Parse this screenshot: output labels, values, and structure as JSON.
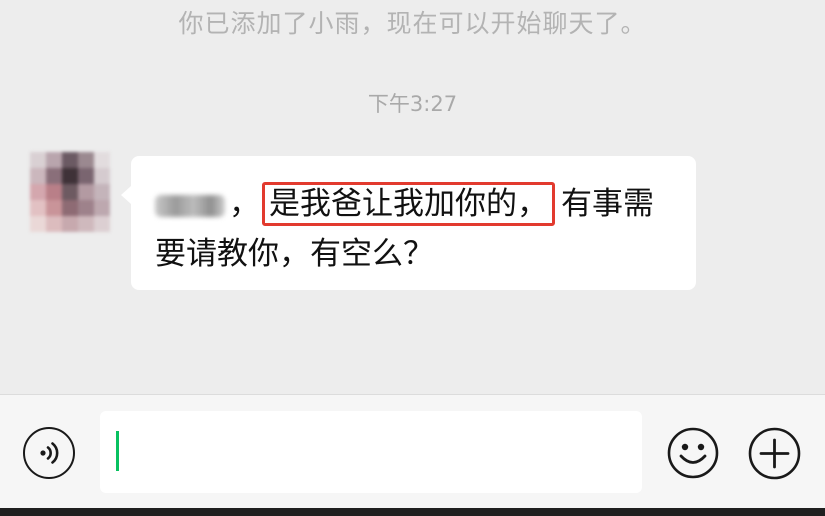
{
  "chat": {
    "system_notice": "你已添加了小雨，现在可以开始聊天了。",
    "timestamp": "下午3:27",
    "message": {
      "prefix_comma": "，",
      "highlighted": "是我爸让我加你的，",
      "rest_line1": "有事需",
      "line2": "要请教你，有空么？"
    }
  },
  "input_bar": {
    "voice_icon": "voice-wave-icon",
    "emoji_icon": "smiley-face-icon",
    "plus_icon": "plus-circle-icon",
    "input_value": ""
  },
  "colors": {
    "background": "#ededed",
    "bubble": "#ffffff",
    "highlight_border": "#e23a2e",
    "caret": "#07c160"
  }
}
